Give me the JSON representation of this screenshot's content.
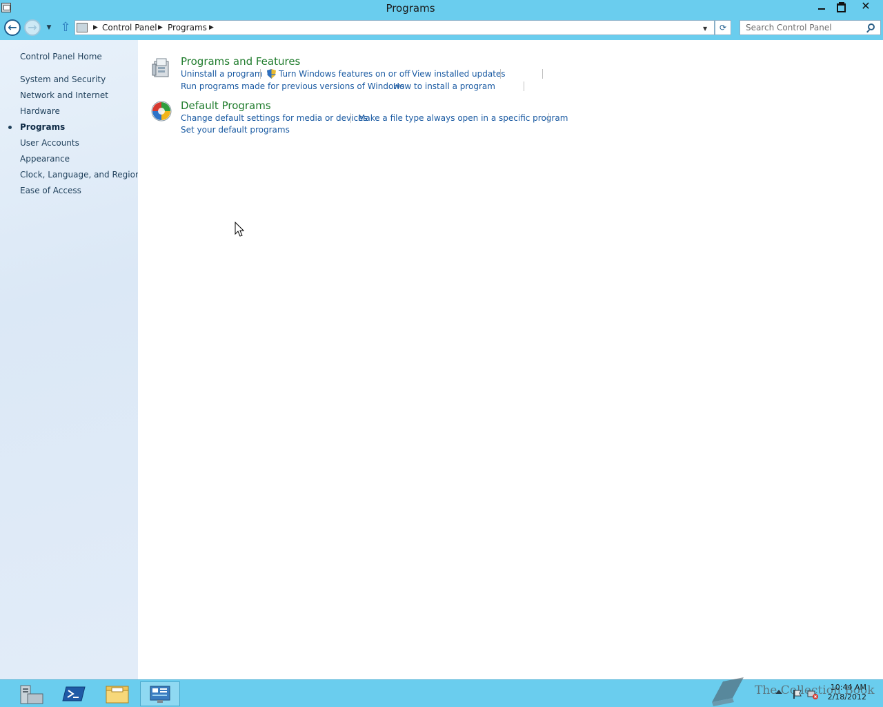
{
  "window": {
    "title": "Programs",
    "minimize_label": "",
    "close_glyph": "✕"
  },
  "nav": {
    "back_glyph": "←",
    "forward_glyph": "→",
    "up_glyph": "⇧",
    "breadcrumbs": [
      "Control Panel",
      "Programs"
    ],
    "search_placeholder": "Search Control Panel"
  },
  "sidebar": {
    "home": "Control Panel Home",
    "items": [
      {
        "label": "System and Security"
      },
      {
        "label": "Network and Internet"
      },
      {
        "label": "Hardware"
      },
      {
        "label": "Programs",
        "active": true
      },
      {
        "label": "User Accounts"
      },
      {
        "label": "Appearance"
      },
      {
        "label": "Clock, Language, and Region"
      },
      {
        "label": "Ease of Access"
      }
    ]
  },
  "categories": [
    {
      "title": "Programs and Features",
      "icon": "programs-features-icon",
      "links": [
        "Uninstall a program",
        "Turn Windows features on or off",
        "View installed updates",
        "Run programs made for previous versions of Windows",
        "How to install a program"
      ]
    },
    {
      "title": "Default Programs",
      "icon": "default-programs-icon",
      "links": [
        "Change default settings for media or devices",
        "Make a file type always open in a specific program",
        "Set your default programs"
      ]
    }
  ],
  "taskbar": {
    "items": [
      "server-manager-icon",
      "powershell-icon",
      "file-explorer-icon",
      "control-panel-icon"
    ],
    "clock_time": "10:44 AM",
    "clock_date": "2/18/2012",
    "watermark": "The Collection Book"
  },
  "colors": {
    "accent": "#6acdee",
    "category_title": "#1e7b2b",
    "link": "#1a5aa2"
  }
}
